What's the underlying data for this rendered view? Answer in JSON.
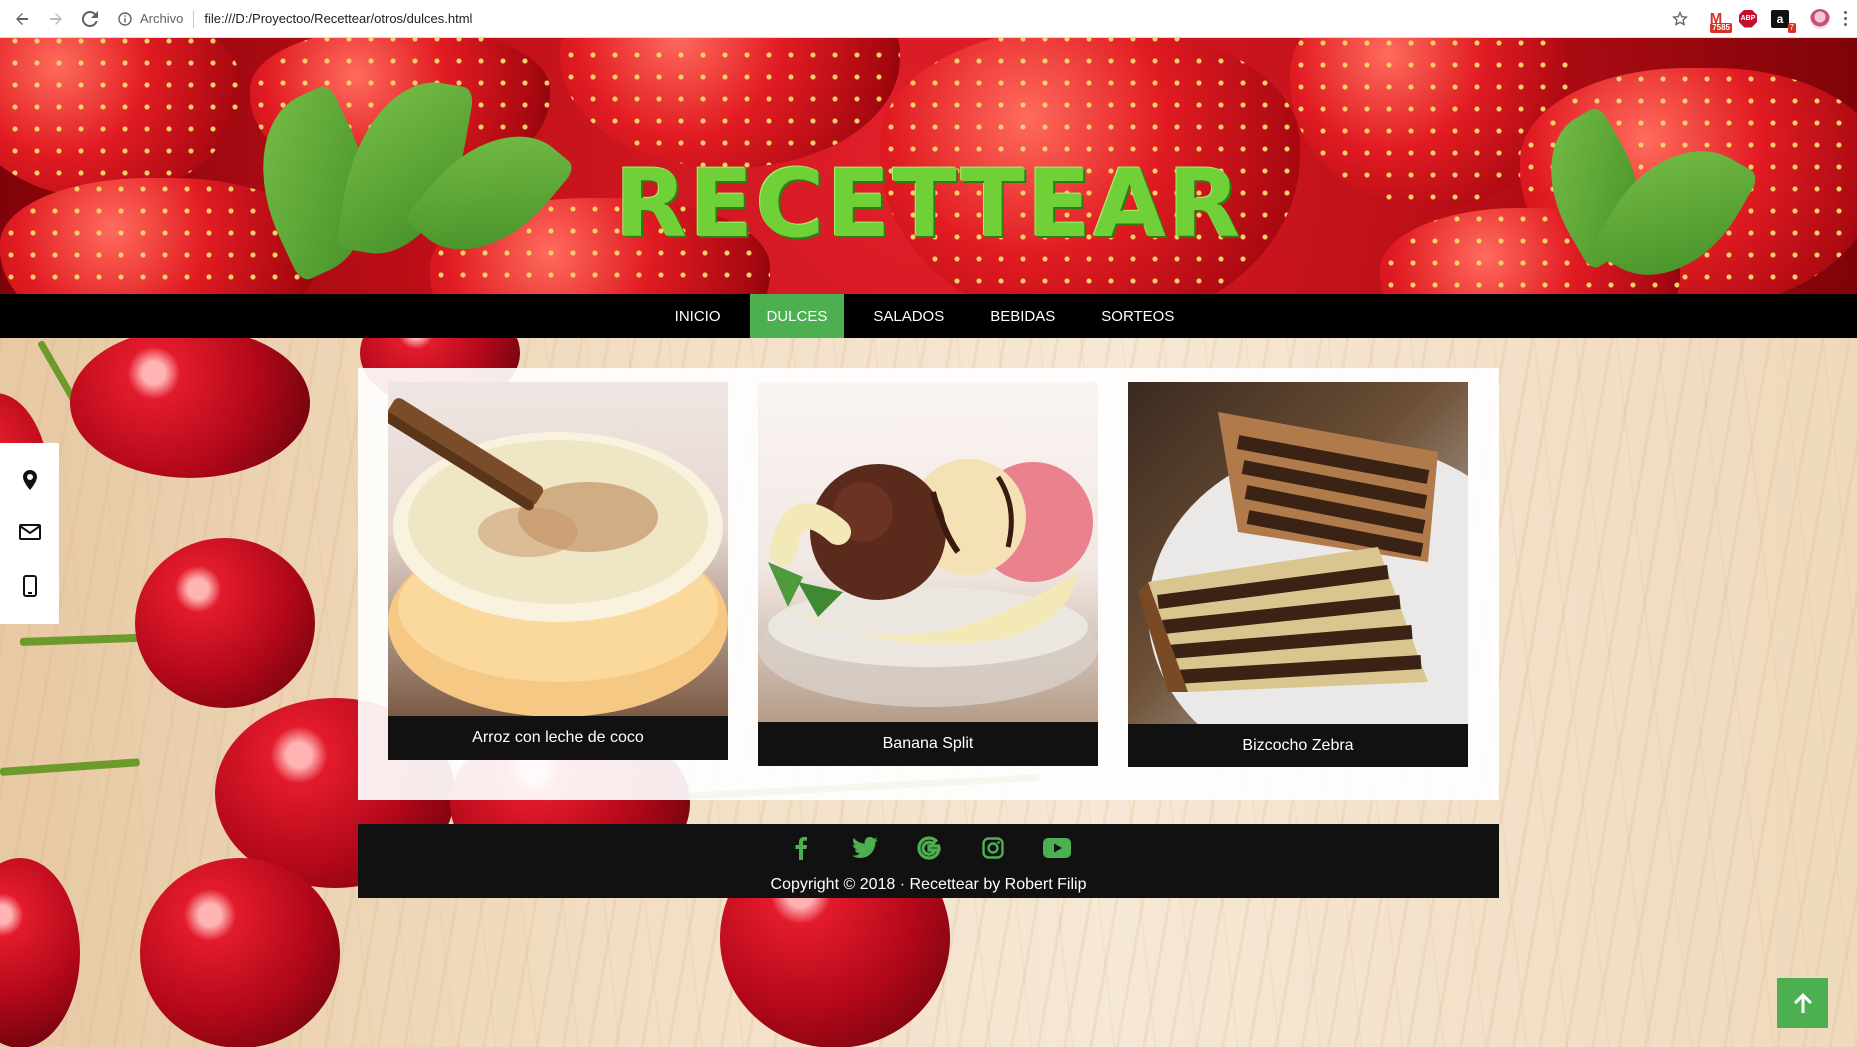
{
  "browser": {
    "security_label": "Archivo",
    "url": "file:///D:/Proyectoo/Recettear/otros/dulces.html",
    "gmail_badge": "7585",
    "abp_label": "ABP",
    "amazon_label": "a",
    "amazon_badge": "7"
  },
  "header": {
    "title": "RECETTEAR"
  },
  "nav": {
    "items": [
      {
        "label": "INICIO"
      },
      {
        "label": "DULCES"
      },
      {
        "label": "SALADOS"
      },
      {
        "label": "BEBIDAS"
      },
      {
        "label": "SORTEOS"
      }
    ],
    "active_color": "#4caf50"
  },
  "side_contacts": [
    "location-icon",
    "mail-icon",
    "phone-icon"
  ],
  "recipes": [
    {
      "title": "Arroz con leche de coco",
      "image": "rice-pudding-image"
    },
    {
      "title": "Banana Split",
      "image": "banana-split-image"
    },
    {
      "title": "Bizcocho Zebra",
      "image": "zebra-cake-image"
    }
  ],
  "footer": {
    "social": [
      "facebook-icon",
      "twitter-icon",
      "google-icon",
      "instagram-icon",
      "youtube-icon"
    ],
    "copyright": "Copyright © 2018 · Recettear by Robert Filip"
  },
  "colors": {
    "accent": "#4caf50",
    "navbar": "#000000",
    "footer": "#111111"
  }
}
